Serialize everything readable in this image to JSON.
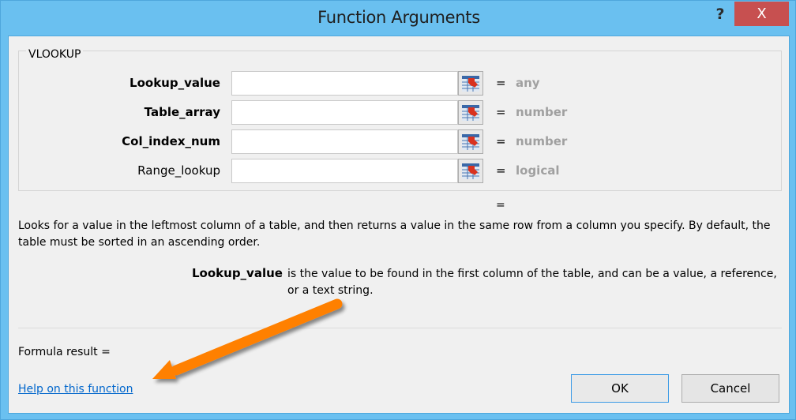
{
  "window": {
    "title": "Function Arguments",
    "help_label": "?",
    "close_label": "X"
  },
  "function": {
    "name": "VLOOKUP",
    "arguments": [
      {
        "label": "Lookup_value",
        "required": true,
        "value": "",
        "result_type": "any"
      },
      {
        "label": "Table_array",
        "required": true,
        "value": "",
        "result_type": "number"
      },
      {
        "label": "Col_index_num",
        "required": true,
        "value": "",
        "result_type": "number"
      },
      {
        "label": "Range_lookup",
        "required": false,
        "value": "",
        "result_type": "logical"
      }
    ],
    "equals_sign": "=",
    "overall_result": "=",
    "description": "Looks for a value in the leftmost column of a table, and then returns a value in the same row from a column you specify. By default, the table must be sorted in an ascending order.",
    "arg_help": {
      "name": "Lookup_value",
      "text": "is the value to be found in the first column of the table, and can be a value, a reference, or a text string."
    }
  },
  "footer": {
    "formula_result_label": "Formula result =",
    "help_link": "Help on this function",
    "ok_label": "OK",
    "cancel_label": "Cancel"
  },
  "annotation": {
    "arrow_color": "#ff8000",
    "points_to": "help-link"
  },
  "colors": {
    "titlebar": "#6ac0f0",
    "close_button": "#c75050",
    "link": "#0066cc",
    "type_text": "#a0a0a0"
  }
}
